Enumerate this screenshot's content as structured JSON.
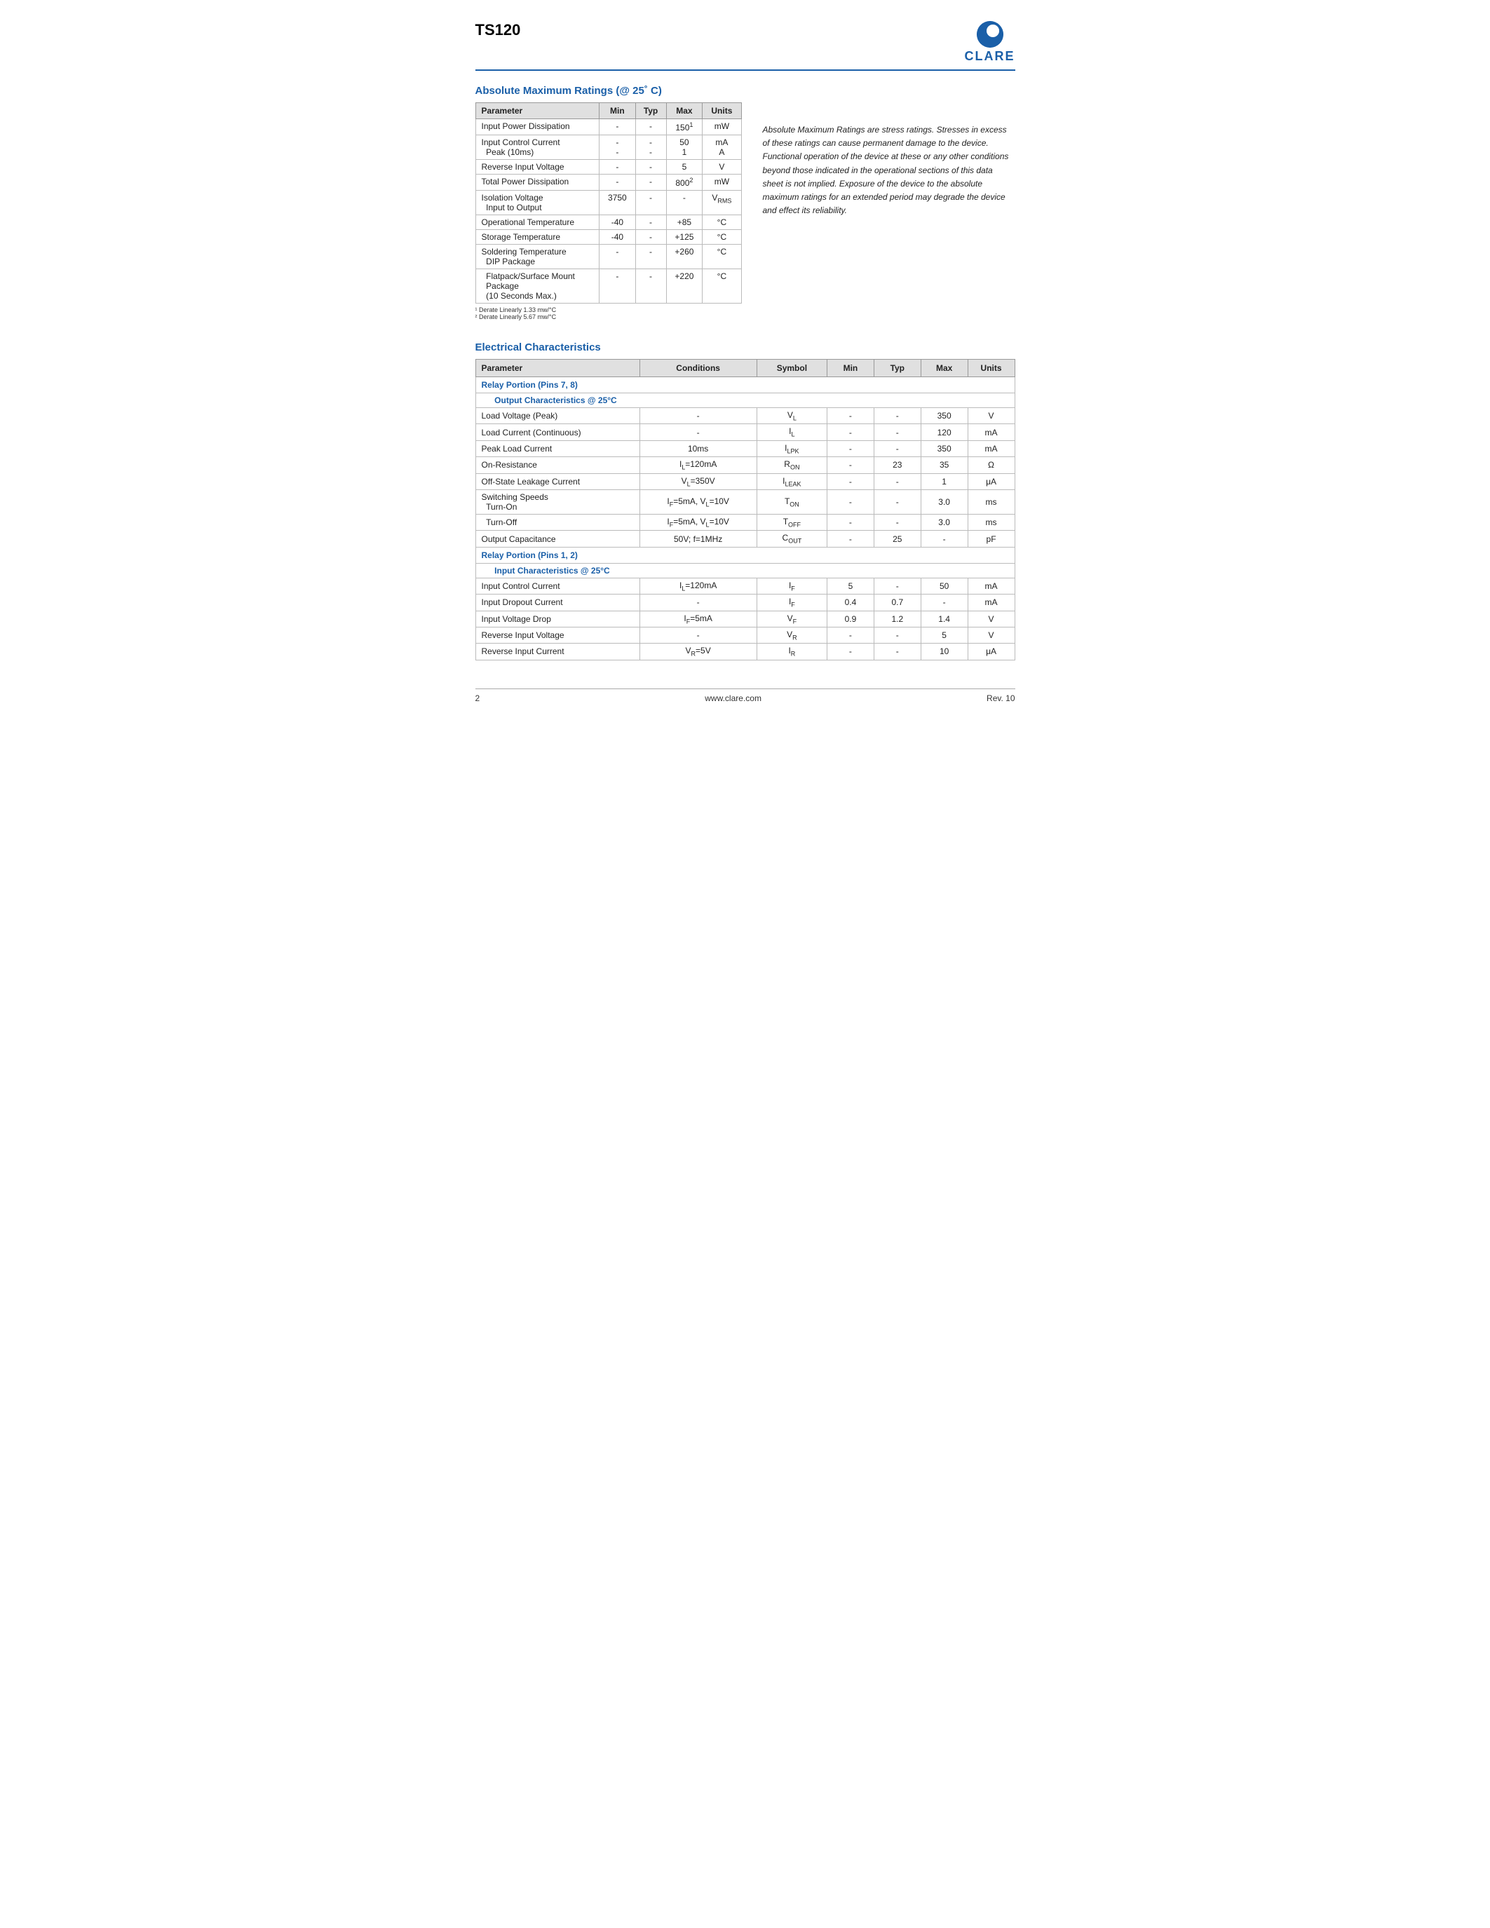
{
  "header": {
    "title": "TS120",
    "logo_text": "CLARE",
    "line_color": "#1a5fa8"
  },
  "amr_section": {
    "title": "Absolute Maximum Ratings (@ 25˚ C)",
    "table": {
      "headers": [
        "Parameter",
        "Min",
        "Typ",
        "Max",
        "Units"
      ],
      "rows": [
        {
          "param": "Input Power Dissipation",
          "min": "-",
          "typ": "-",
          "max": "150¹",
          "units": "mW"
        },
        {
          "param": "Input Control Current\n  Peak (10ms)",
          "min": "-\n-",
          "typ": "-\n-",
          "max": "50\n1",
          "units": "mA\nA"
        },
        {
          "param": "Reverse Input Voltage",
          "min": "-",
          "typ": "-",
          "max": "5",
          "units": "V"
        },
        {
          "param": "Total Power Dissipation",
          "min": "-",
          "typ": "-",
          "max": "800²",
          "units": "mW"
        },
        {
          "param": "Isolation Voltage\n  Input to Output",
          "min": "3750",
          "typ": "-",
          "max": "-",
          "units": "VRMS"
        },
        {
          "param": "Operational Temperature",
          "min": "-40",
          "typ": "-",
          "max": "+85",
          "units": "°C"
        },
        {
          "param": "Storage Temperature",
          "min": "-40",
          "typ": "-",
          "max": "+125",
          "units": "°C"
        },
        {
          "param": "Soldering Temperature\n  DIP Package",
          "min": "-",
          "typ": "-",
          "max": "+260",
          "units": "°C"
        },
        {
          "param": "  Flatpack/Surface Mount\n  Package\n  (10 Seconds Max.)",
          "min": "-",
          "typ": "-",
          "max": "+220",
          "units": "°C"
        }
      ]
    },
    "footnote1": "¹  Derate Linearly 1.33 mw/°C",
    "footnote2": "²  Derate Linearly 5.67 mw/°C",
    "note_text": "Absolute Maximum Ratings are stress ratings. Stresses in excess of these ratings can cause permanent damage to the device. Functional operation of the device at these or any other conditions beyond those indicated in the operational sections of this data sheet is not implied. Exposure of the device to the absolute maximum ratings for an extended period may degrade the device and effect its reliability."
  },
  "ec_section": {
    "title": "Electrical Characteristics",
    "table": {
      "headers": [
        "Parameter",
        "Conditions",
        "Symbol",
        "Min",
        "Typ",
        "Max",
        "Units"
      ],
      "rows": [
        {
          "type": "section",
          "param": "Relay Portion (Pins 7, 8)"
        },
        {
          "type": "subsection",
          "param": "Output Characteristics @ 25°C"
        },
        {
          "type": "data",
          "param": "Load Voltage (Peak)",
          "cond": "-",
          "sym": "V_L",
          "min": "-",
          "typ": "-",
          "max": "350",
          "units": "V"
        },
        {
          "type": "data",
          "param": "Load Current (Continuous)",
          "cond": "-",
          "sym": "I_L",
          "min": "-",
          "typ": "-",
          "max": "120",
          "units": "mA"
        },
        {
          "type": "data",
          "param": "Peak Load Current",
          "cond": "10ms",
          "sym": "I_LPK",
          "min": "-",
          "typ": "-",
          "max": "350",
          "units": "mA"
        },
        {
          "type": "data",
          "param": "On-Resistance",
          "cond": "I_L=120mA",
          "sym": "R_ON",
          "min": "-",
          "typ": "23",
          "max": "35",
          "units": "Ω"
        },
        {
          "type": "data",
          "param": "Off-State Leakage Current",
          "cond": "V_L=350V",
          "sym": "I_LEAK",
          "min": "-",
          "typ": "-",
          "max": "1",
          "units": "μA"
        },
        {
          "type": "data",
          "param": "Switching Speeds\n  Turn-On",
          "cond": "I_F=5mA, V_L=10V",
          "sym": "T_ON",
          "min": "-",
          "typ": "-",
          "max": "3.0",
          "units": "ms"
        },
        {
          "type": "data",
          "param": "  Turn-Off",
          "cond": "I_F=5mA, V_L=10V",
          "sym": "T_OFF",
          "min": "-",
          "typ": "-",
          "max": "3.0",
          "units": "ms"
        },
        {
          "type": "data",
          "param": "Output Capacitance",
          "cond": "50V; f=1MHz",
          "sym": "C_OUT",
          "min": "-",
          "typ": "25",
          "max": "-",
          "units": "pF"
        },
        {
          "type": "section",
          "param": "Relay Portion (Pins 1, 2)"
        },
        {
          "type": "subsection",
          "param": "Input Characteristics @ 25°C"
        },
        {
          "type": "data",
          "param": "Input Control Current",
          "cond": "I_L=120mA",
          "sym": "I_F",
          "min": "5",
          "typ": "-",
          "max": "50",
          "units": "mA"
        },
        {
          "type": "data",
          "param": "Input Dropout Current",
          "cond": "-",
          "sym": "I_F",
          "min": "0.4",
          "typ": "0.7",
          "max": "-",
          "units": "mA"
        },
        {
          "type": "data",
          "param": "Input Voltage Drop",
          "cond": "I_F=5mA",
          "sym": "V_F",
          "min": "0.9",
          "typ": "1.2",
          "max": "1.4",
          "units": "V"
        },
        {
          "type": "data",
          "param": "Reverse Input Voltage",
          "cond": "-",
          "sym": "V_R",
          "min": "-",
          "typ": "-",
          "max": "5",
          "units": "V"
        },
        {
          "type": "data",
          "param": "Reverse Input Current",
          "cond": "V_R=5V",
          "sym": "I_R",
          "min": "-",
          "typ": "-",
          "max": "10",
          "units": "μA"
        }
      ]
    }
  },
  "footer": {
    "page": "2",
    "website": "www.clare.com",
    "revision": "Rev. 10"
  }
}
